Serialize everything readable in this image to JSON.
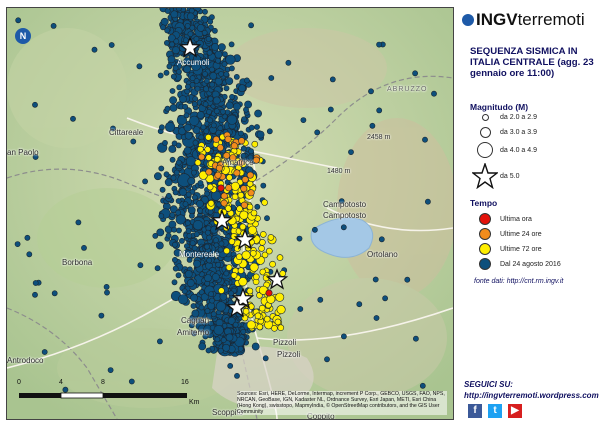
{
  "logo": {
    "ingv": "INGV",
    "terremoti": "terremoti"
  },
  "title": "SEQUENZA SISMICA IN ITALIA CENTRALE (agg. 23 gennaio ore 11:00)",
  "legend": {
    "magnitude_title": "Magnitudo (M)",
    "magnitude_items": [
      {
        "label": "da 2.0 a 2.9",
        "size": "smallest"
      },
      {
        "label": "da 3.0 a 3.9",
        "size": "small"
      },
      {
        "label": "da 4.0 a 4.9",
        "size": "medium"
      },
      {
        "label": "da 5.0",
        "symbol": "star"
      }
    ],
    "time_title": "Tempo",
    "time_items": [
      {
        "label": "Ultima ora",
        "color": "#e3120b"
      },
      {
        "label": "Ultime 24 ore",
        "color": "#f28c1c"
      },
      {
        "label": "Ultime 72 ore",
        "color": "#ffee00"
      },
      {
        "label": "Dal 24 agosto 2016",
        "color": "#0d4f7c"
      }
    ],
    "source": "fonte dati: http://cnt.rm.ingv.it"
  },
  "follow": {
    "label": "SEGUICI SU:",
    "blog": "http://ingvterremoti.wordpress.com"
  },
  "social": [
    {
      "name": "facebook",
      "glyph": "f",
      "color": "#3b5998"
    },
    {
      "name": "twitter",
      "glyph": "t",
      "color": "#1da1f2"
    },
    {
      "name": "youtube",
      "glyph": "▶",
      "color": "#d71f1f"
    }
  ],
  "places": {
    "accumoli": "Accumoli",
    "amatrice": "Amatrice",
    "cittareale": "Cittareale",
    "san_paolo": "an Paolo",
    "borbona": "Borbona",
    "montereale": "Montereale",
    "campotosto": "Campotosto",
    "ortolano": "Ortolano",
    "cagnano": "Cagnan",
    "amiterno": "Amiterno",
    "pizzoli": "Pizzoli",
    "pizzoli2": "Pizzoli",
    "antrodoco": "Antrodoco",
    "abruzzo": "ABRUZZO",
    "scoppito": "Scoppito",
    "coppito": "Coppito",
    "elev1": "2458 m",
    "elev2": "1480 m",
    "elev3": "2"
  },
  "scale": {
    "ticks": [
      "0",
      "4",
      "8",
      "16"
    ],
    "unit": "Km"
  },
  "attribution": "Sources: Esri, HERE, DeLorme, Intermap, increment P Corp., GEBCO, USGS, FAO, NPS, NRCAN, GeoBase, IGN, Kadaster NL, Ordnance Survey, Esri Japan, METI, Esri China (Hong Kong), swisstopo, MapmyIndia, © OpenStreetMap contributors, and the GIS User Community",
  "map_data": {
    "lake": "Lago di Campotosto",
    "colors": {
      "old": "#0d4f7c",
      "h72": "#ffee00",
      "h24": "#f28c1c",
      "h1": "#e3120b"
    },
    "mainshocks_m5": 6
  }
}
